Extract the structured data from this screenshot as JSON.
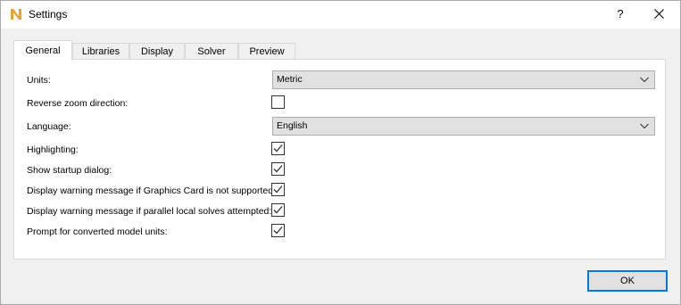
{
  "window": {
    "title": "Settings",
    "help_label": "?",
    "app_icon_letter": "N",
    "app_icon_color": "#e8a13b"
  },
  "tabs": [
    {
      "label": "General",
      "active": true
    },
    {
      "label": "Libraries",
      "active": false
    },
    {
      "label": "Display",
      "active": false
    },
    {
      "label": "Solver",
      "active": false
    },
    {
      "label": "Preview",
      "active": false
    }
  ],
  "settings": {
    "units": {
      "label": "Units:",
      "value": "Metric"
    },
    "reverse_zoom": {
      "label": "Reverse zoom direction:",
      "checked": false
    },
    "language": {
      "label": "Language:",
      "value": "English"
    },
    "highlighting": {
      "label": "Highlighting:",
      "checked": true
    },
    "startup_dialog": {
      "label": "Show startup dialog:",
      "checked": true
    },
    "gpu_warning": {
      "label": "Display warning message if Graphics Card is not supported:",
      "checked": true
    },
    "parallel_warning": {
      "label": "Display warning message if parallel local solves attempted:",
      "checked": true
    },
    "converted_units": {
      "label": "Prompt for converted model units:",
      "checked": true
    }
  },
  "footer": {
    "ok_label": "OK"
  },
  "colors": {
    "accent": "#0078d7",
    "panel_bg": "#ffffff",
    "dialog_bg": "#f0f0f0"
  }
}
